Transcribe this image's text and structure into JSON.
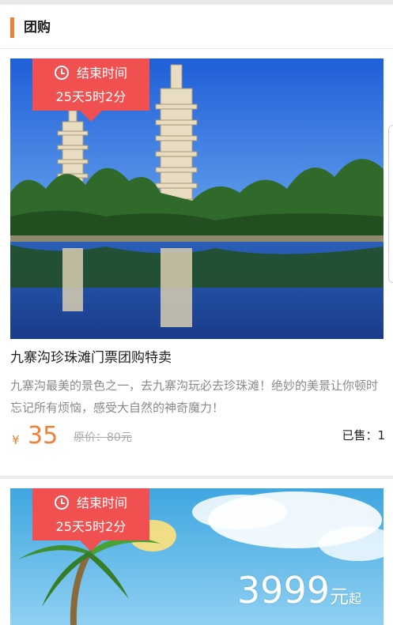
{
  "header": {
    "title": "团购"
  },
  "deals": [
    {
      "ribbon": {
        "label": "结束时间",
        "countdown": "25天5时2分"
      },
      "title": "九寨沟珍珠滩门票团购特卖",
      "description": "九寨沟最美的景色之一，去九寨沟玩必去珍珠滩！绝妙的美景让你顿时忘记所有烦恼，感受大自然的神奇魔力！",
      "currency": "¥",
      "price": "35",
      "original_price": "原价：80元",
      "sold": "已售：1"
    },
    {
      "ribbon": {
        "label": "结束时间",
        "countdown": "25天5时2分"
      },
      "promo": {
        "price": "3999",
        "unit": "元",
        "suffix": "起"
      }
    }
  ],
  "colors": {
    "accent": "#f08035",
    "ribbon": "#f05050",
    "price": "#f08035"
  }
}
